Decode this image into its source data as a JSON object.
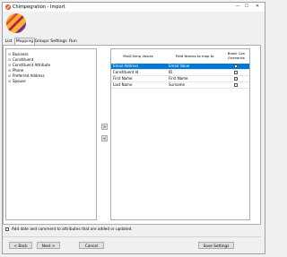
{
  "window": {
    "title": "Chimpegration - Import",
    "minimize_glyph": "—",
    "maximize_glyph": "☐",
    "close_glyph": "✕",
    "logo_colors": [
      "#e94e3c",
      "#f5a623",
      "#7b2d8b",
      "#c2185b"
    ]
  },
  "tabs": [
    {
      "label": "List"
    },
    {
      "label": "Mapping"
    },
    {
      "label": "Groups"
    },
    {
      "label": "Settings"
    },
    {
      "label": "Run"
    }
  ],
  "tree": {
    "items": [
      {
        "label": "Business",
        "expander": "⊞"
      },
      {
        "label": "Constituent",
        "expander": "⊞"
      },
      {
        "label": "Constituent Attribute",
        "expander": "⊞"
      },
      {
        "label": "Phone",
        "expander": "⊞"
      },
      {
        "label": "Preferred Address",
        "expander": "⊞"
      },
      {
        "label": "Spouse",
        "expander": "⊞"
      }
    ]
  },
  "move_buttons": {
    "add": ">",
    "remove": "<"
  },
  "grid": {
    "headers": {
      "mailchimp": "MailChimp Values",
      "field": "Field Names to map to",
      "blank": "Blank Can Overwrite"
    },
    "rows": [
      {
        "mailchimp": "Email Address",
        "field": "Email Value",
        "blank_checked": false,
        "selected": true
      },
      {
        "mailchimp": "Constituent Id",
        "field": "ID",
        "blank_checked": false,
        "selected": false
      },
      {
        "mailchimp": "First Name",
        "field": "First Name",
        "blank_checked": false,
        "selected": false
      },
      {
        "mailchimp": "Last Name",
        "field": "Surname",
        "blank_checked": false,
        "selected": false
      }
    ]
  },
  "footer": {
    "checkbox_label": "Add date and comment to attributes that are added or updated.",
    "checkbox_checked": false
  },
  "buttons": {
    "back": "< Back",
    "next": "Next >",
    "cancel": "Cancel",
    "save_settings": "Save Settings"
  }
}
